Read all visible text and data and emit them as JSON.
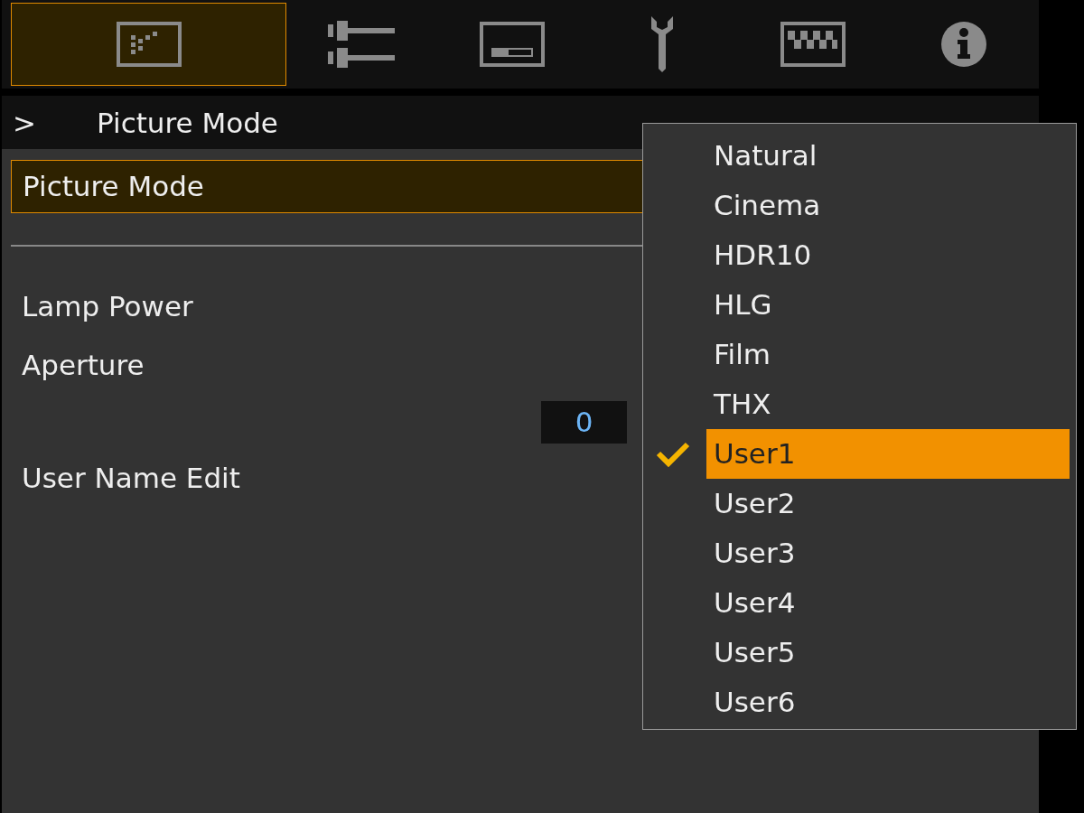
{
  "tabs": [
    {
      "kind": "picture",
      "selected": true
    },
    {
      "kind": "sliders",
      "selected": false
    },
    {
      "kind": "screen",
      "selected": false
    },
    {
      "kind": "wrench",
      "selected": false
    },
    {
      "kind": "pattern",
      "selected": false
    },
    {
      "kind": "info",
      "selected": false
    }
  ],
  "breadcrumb": {
    "marker": ">",
    "title": "Picture Mode"
  },
  "menu_items": [
    {
      "label": "Picture Mode",
      "selected": true
    },
    {
      "label": "Lamp Power",
      "selected": false
    },
    {
      "label": "Aperture",
      "selected": false,
      "value": "0"
    },
    {
      "label": "User Name Edit",
      "selected": false
    }
  ],
  "dropdown": {
    "options": [
      {
        "label": "Natural",
        "selected": false
      },
      {
        "label": "Cinema",
        "selected": false
      },
      {
        "label": "HDR10",
        "selected": false
      },
      {
        "label": "HLG",
        "selected": false
      },
      {
        "label": "Film",
        "selected": false
      },
      {
        "label": "THX",
        "selected": false
      },
      {
        "label": "User1",
        "selected": true
      },
      {
        "label": "User2",
        "selected": false
      },
      {
        "label": "User3",
        "selected": false
      },
      {
        "label": "User4",
        "selected": false
      },
      {
        "label": "User5",
        "selected": false
      },
      {
        "label": "User6",
        "selected": false
      }
    ]
  }
}
